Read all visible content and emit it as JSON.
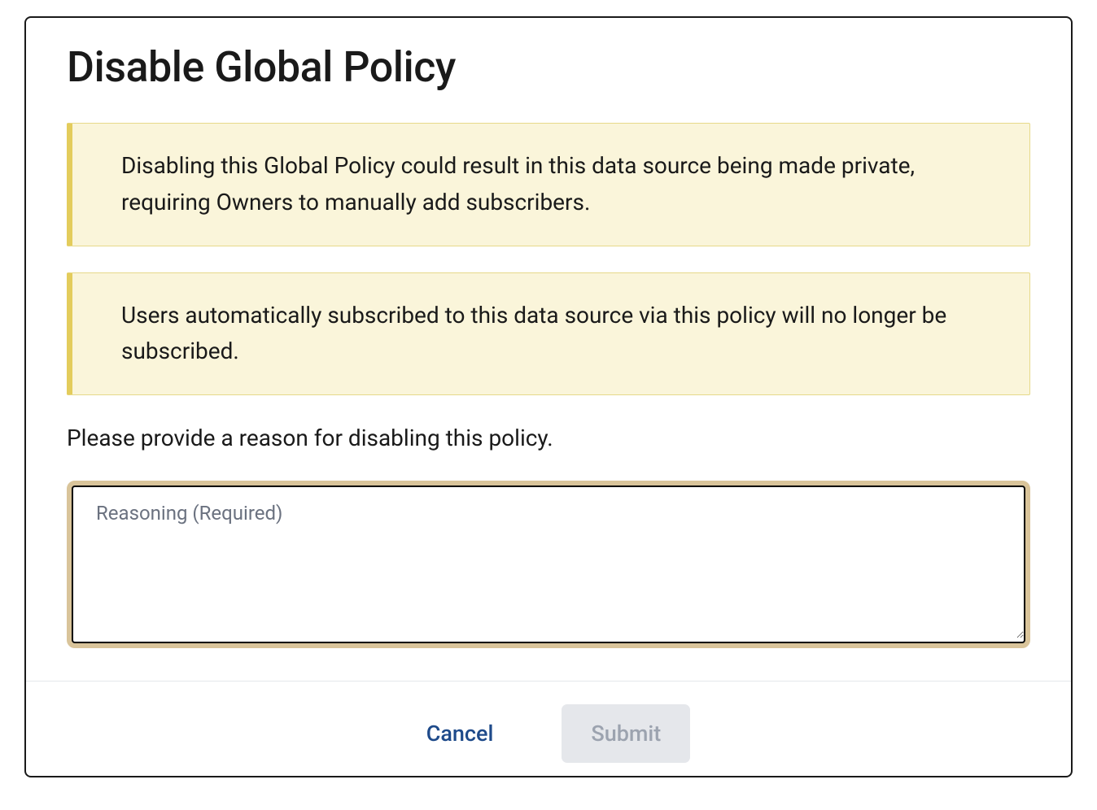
{
  "modal": {
    "title": "Disable Global Policy",
    "warnings": [
      "Disabling this Global Policy could result in this data source being made private, requiring Owners to manually add subscribers.",
      "Users automatically subscribed to this data source via this policy will no longer be subscribed."
    ],
    "prompt_label": "Please provide a reason for disabling this policy.",
    "textarea": {
      "floating_label": "Reasoning (Required)",
      "value": ""
    },
    "buttons": {
      "cancel": "Cancel",
      "submit": "Submit"
    }
  }
}
